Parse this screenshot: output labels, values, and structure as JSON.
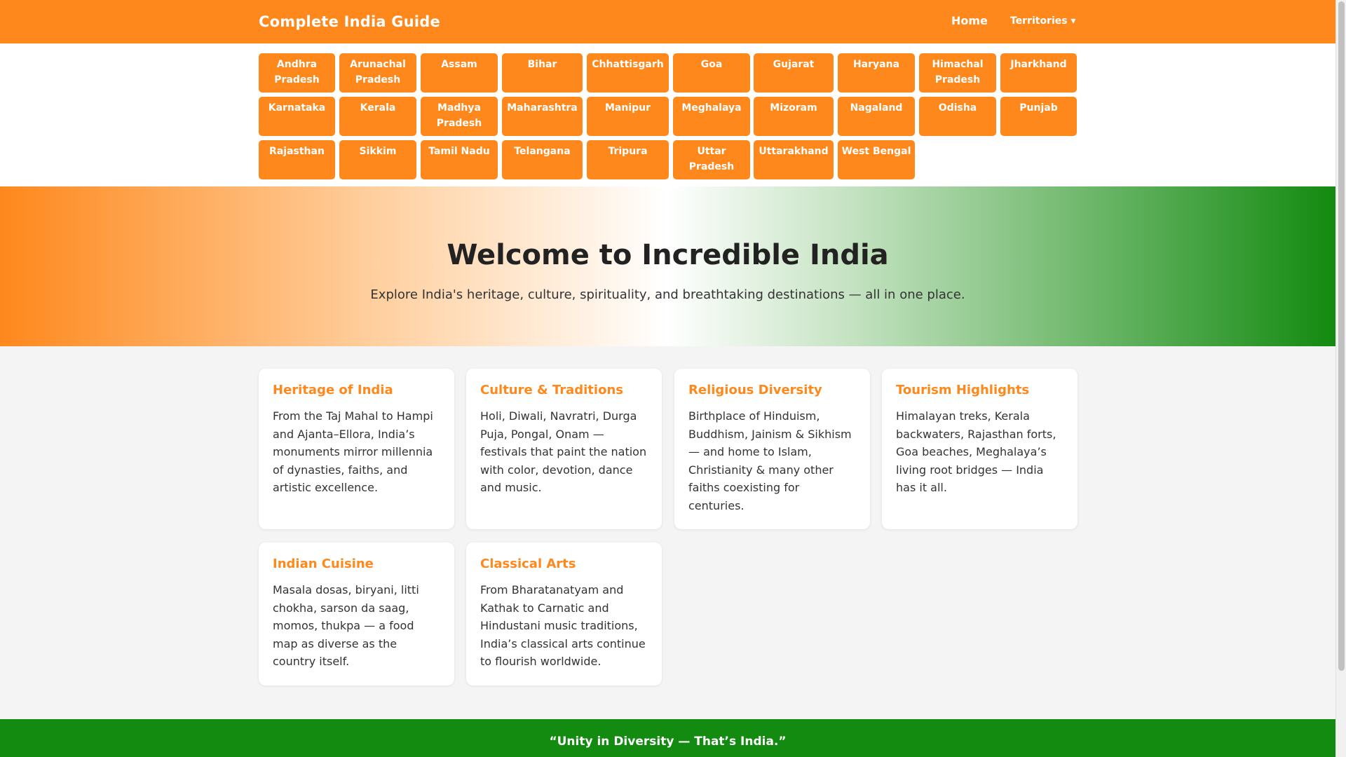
{
  "header": {
    "brand": "Complete India Guide",
    "home": "Home",
    "territories": "Territories ▾"
  },
  "states": [
    "Andhra Pradesh",
    "Arunachal Pradesh",
    "Assam",
    "Bihar",
    "Chhattisgarh",
    "Goa",
    "Gujarat",
    "Haryana",
    "Himachal Pradesh",
    "Jharkhand",
    "Karnataka",
    "Kerala",
    "Madhya Pradesh",
    "Maharashtra",
    "Manipur",
    "Meghalaya",
    "Mizoram",
    "Nagaland",
    "Odisha",
    "Punjab",
    "Rajasthan",
    "Sikkim",
    "Tamil Nadu",
    "Telangana",
    "Tripura",
    "Uttar Pradesh",
    "Uttarakhand",
    "West Bengal"
  ],
  "hero": {
    "title": "Welcome to Incredible India",
    "subtitle": "Explore India's heritage, culture, spirituality, and breathtaking destinations — all in one place."
  },
  "cards": [
    {
      "title": "Heritage of India",
      "text": "From the Taj Mahal to Hampi and Ajanta–Ellora, India’s monuments mirror millennia of dynasties, faiths, and artistic excellence."
    },
    {
      "title": "Culture & Traditions",
      "text": "Holi, Diwali, Navratri, Durga Puja, Pongal, Onam — festivals that paint the nation with color, devotion, dance and music."
    },
    {
      "title": "Religious Diversity",
      "text": "Birthplace of Hinduism, Buddhism, Jainism & Sikhism — and home to Islam, Christianity & many other faiths coexisting for centuries."
    },
    {
      "title": "Tourism Highlights",
      "text": "Himalayan treks, Kerala backwaters, Rajasthan forts, Goa beaches, Meghalaya’s living root bridges — India has it all."
    },
    {
      "title": "Indian Cuisine",
      "text": "Masala dosas, biryani, litti chokha, sarson da saag, momos, thukpa — a food map as diverse as the country itself."
    },
    {
      "title": "Classical Arts",
      "text": "From Bharatanatyam and Kathak to Carnatic and Hindustani music traditions, India’s classical arts continue to flourish worldwide."
    }
  ],
  "footer": {
    "quote": "“Unity in Diversity — That’s India.”"
  },
  "colors": {
    "saffron": "#fe881c",
    "green": "#138a10",
    "white": "#ffffff"
  }
}
